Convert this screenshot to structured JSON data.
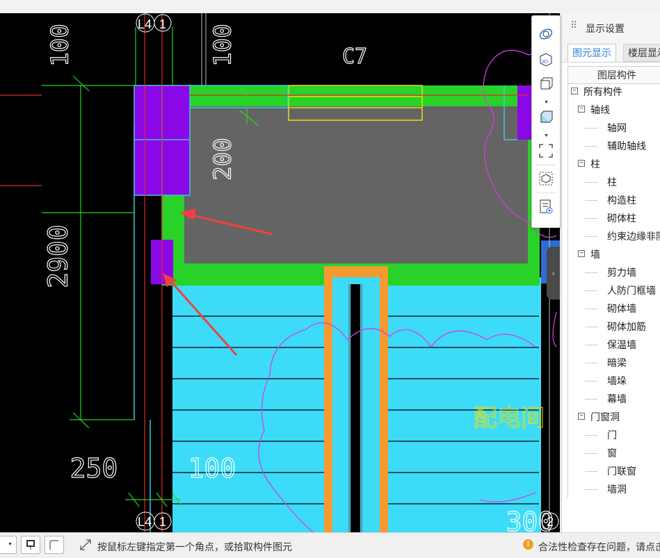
{
  "canvas": {
    "dims": {
      "top_left": "100",
      "top_mid": "100",
      "wall": "200",
      "height": "2900",
      "bottom_left": "250",
      "bottom_mid": "100",
      "bottom_right": "300"
    },
    "axis_labels": {
      "top_l4": "L4",
      "top_1": "1",
      "bottom_l4": "L4",
      "bottom_1": "1",
      "right_2": "2"
    },
    "window_tag": "C7",
    "room_name": "配电间"
  },
  "view_toolbar": {
    "items": [
      "orbit-icon",
      "3d-view-icon",
      "cube-outline-icon",
      "cube-solid-icon",
      "fit-view-icon",
      "isolate-icon",
      "display-list-icon"
    ]
  },
  "panel": {
    "title": "显示设置",
    "tabs": [
      "图元显示",
      "楼层显示"
    ],
    "tree_header": "图层构件",
    "tree": [
      {
        "label": "所有构件",
        "level": 0,
        "group": true
      },
      {
        "label": "轴线",
        "level": 1,
        "group": true
      },
      {
        "label": "轴网",
        "level": 2,
        "group": false
      },
      {
        "label": "辅助轴线",
        "level": 2,
        "group": false
      },
      {
        "label": "柱",
        "level": 1,
        "group": true
      },
      {
        "label": "柱",
        "level": 2,
        "group": false
      },
      {
        "label": "构造柱",
        "level": 2,
        "group": false
      },
      {
        "label": "砌体柱",
        "level": 2,
        "group": false
      },
      {
        "label": "约束边缘非阴影区",
        "level": 2,
        "group": false
      },
      {
        "label": "墙",
        "level": 1,
        "group": true
      },
      {
        "label": "剪力墙",
        "level": 2,
        "group": false
      },
      {
        "label": "人防门框墙",
        "level": 2,
        "group": false
      },
      {
        "label": "砌体墙",
        "level": 2,
        "group": false
      },
      {
        "label": "砌体加筋",
        "level": 2,
        "group": false
      },
      {
        "label": "保温墙",
        "level": 2,
        "group": false
      },
      {
        "label": "暗梁",
        "level": 2,
        "group": false
      },
      {
        "label": "墙垛",
        "level": 2,
        "group": false
      },
      {
        "label": "幕墙",
        "level": 2,
        "group": false
      },
      {
        "label": "门窗洞",
        "level": 1,
        "group": true
      },
      {
        "label": "门",
        "level": 2,
        "group": false
      },
      {
        "label": "窗",
        "level": 2,
        "group": false
      },
      {
        "label": "门联窗",
        "level": 2,
        "group": false
      },
      {
        "label": "墙洞",
        "level": 2,
        "group": false
      }
    ]
  },
  "status": {
    "hint": "按鼠标左键指定第一个角点，或拾取构件图元",
    "warning": "合法性检查存在问题，请点击查看"
  },
  "colors": {
    "canvas_bg": "#000000",
    "slab_cyan": "#3cdcf8",
    "wall_green": "#28d228",
    "column_purple": "#8a08e6",
    "door_orange": "#f49a30",
    "room_gray": "#646464",
    "dim_green": "#22d822",
    "accent_blue": "#2f7fd8",
    "warning_orange": "#f0a020"
  }
}
